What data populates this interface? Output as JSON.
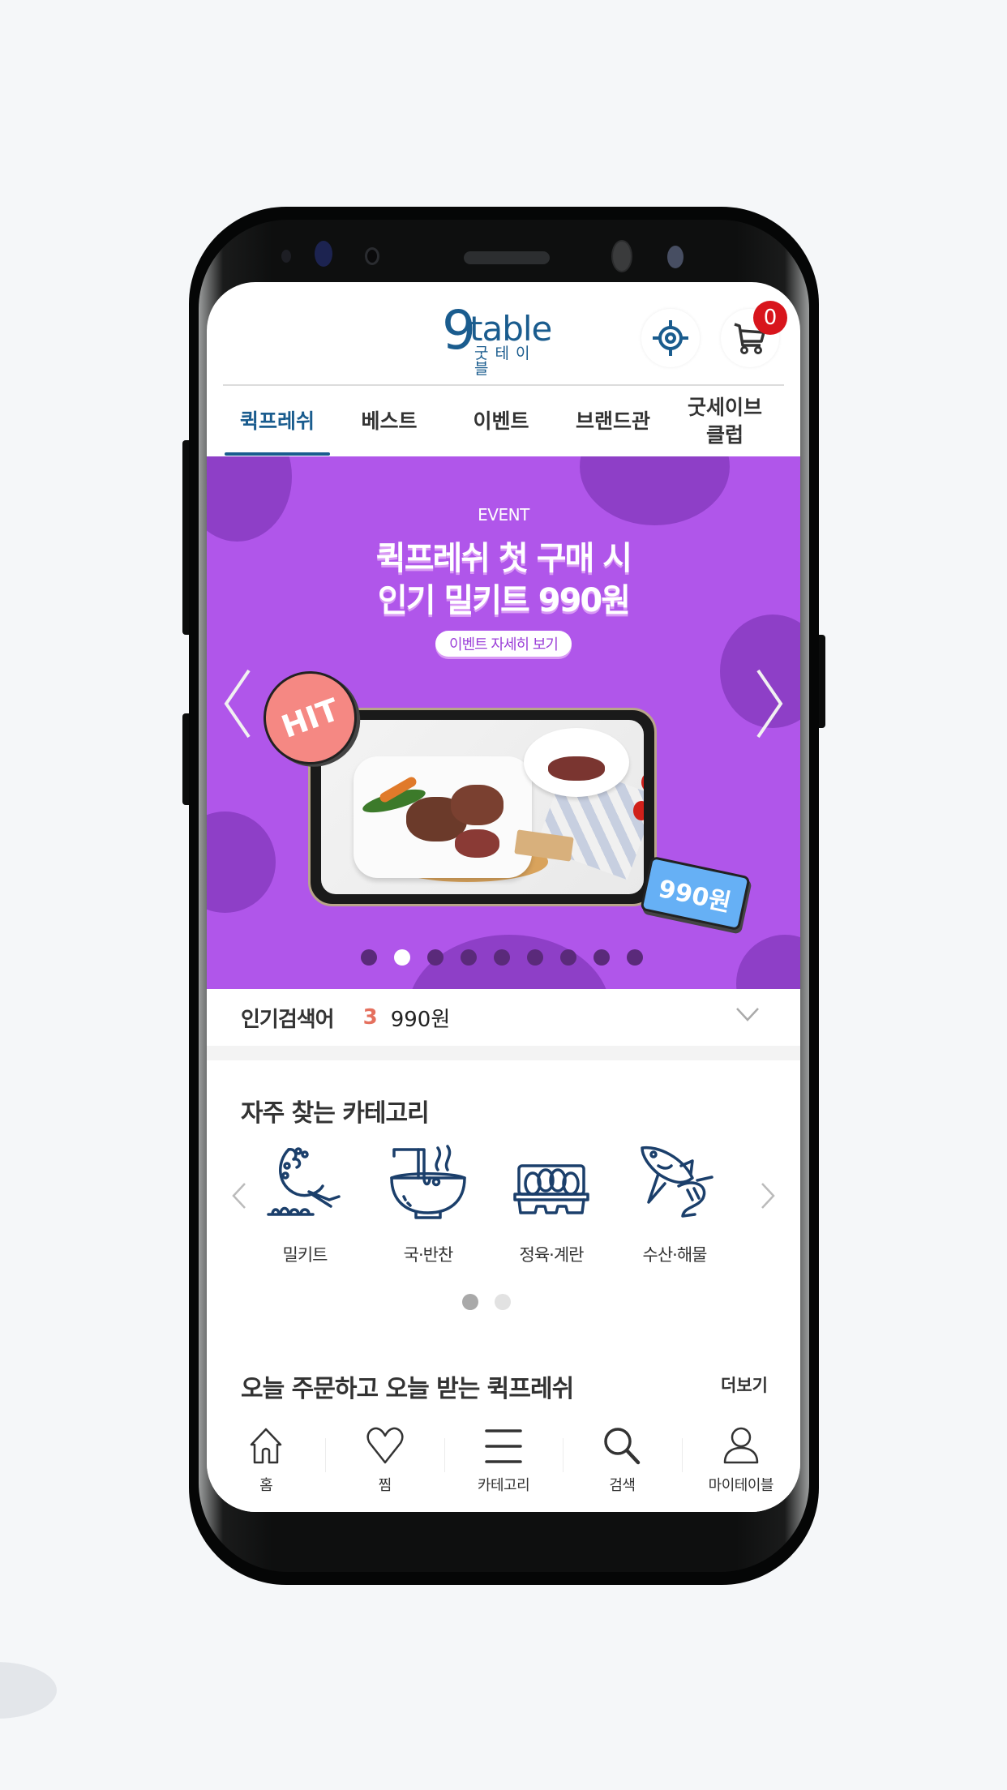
{
  "header": {
    "logo_mark": "9",
    "logo_word": "table",
    "logo_korean": "굿테이블",
    "locate_icon": "crosshair-icon",
    "cart_icon": "cart-icon",
    "cart_count": "0"
  },
  "tabs": [
    {
      "label": "퀵프레쉬",
      "active": true
    },
    {
      "label": "베스트",
      "active": false
    },
    {
      "label": "이벤트",
      "active": false
    },
    {
      "label": "브랜드관",
      "active": false
    },
    {
      "label": "굿세이브\n클럽",
      "active": false
    }
  ],
  "banner": {
    "eyebrow": "EVENT",
    "title_line1": "퀵프레쉬 첫 구매 시",
    "title_line2": "인기 밀키트 990원",
    "cta": "이벤트 자세히 보기",
    "badge": "HIT",
    "price_tag": "990원",
    "slide_count": 9,
    "active_slide": 2,
    "colors": {
      "background": "#b056ea",
      "blob": "#8e3fc7"
    }
  },
  "popular_search": {
    "label": "인기검색어",
    "rank": "3",
    "term": "990원"
  },
  "categories": {
    "title": "자주 찾는 카테고리",
    "items": [
      {
        "label": "밀키트",
        "icon": "wok-cooking-icon"
      },
      {
        "label": "국·반찬",
        "icon": "soup-bowl-icon"
      },
      {
        "label": "정육·계란",
        "icon": "egg-carton-icon"
      },
      {
        "label": "수산·해물",
        "icon": "fish-shrimp-icon"
      }
    ],
    "page_count": 2,
    "active_page": 1
  },
  "quick_section": {
    "title": "오늘 주문하고 오늘 받는 퀵프레쉬",
    "more": "더보기"
  },
  "bottom_nav": [
    {
      "label": "홈",
      "icon": "home-icon"
    },
    {
      "label": "찜",
      "icon": "heart-icon"
    },
    {
      "label": "카테고리",
      "icon": "menu-icon"
    },
    {
      "label": "검색",
      "icon": "search-icon"
    },
    {
      "label": "마이테이블",
      "icon": "user-icon"
    }
  ],
  "colors": {
    "brand": "#1a5c8e",
    "badge_red": "#d8151c",
    "rank_accent": "#e5705e"
  }
}
